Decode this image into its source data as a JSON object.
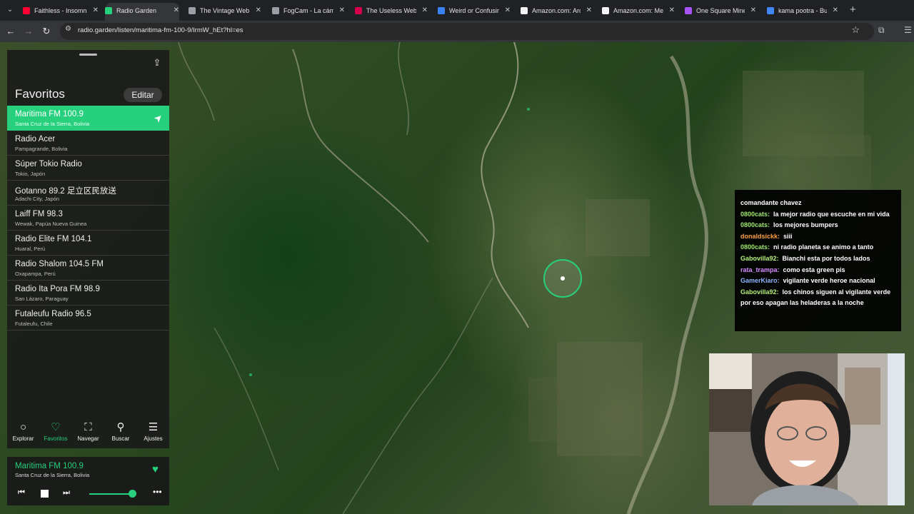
{
  "browser": {
    "tabs": [
      {
        "title": "Faithless - Insomnia",
        "favicon_color": "#ff0033",
        "active": false
      },
      {
        "title": "Radio Garden",
        "favicon_color": "#26d07c",
        "active": true
      },
      {
        "title": "The Vintage Web",
        "favicon_color": "#9aa0a6",
        "active": false
      },
      {
        "title": "FogCam - La cámara",
        "favicon_color": "#9aa0a6",
        "active": false
      },
      {
        "title": "The Useless Web",
        "favicon_color": "#d6004b",
        "active": false
      },
      {
        "title": "Weird or Confusing",
        "favicon_color": "#3b82f6",
        "active": false
      },
      {
        "title": "Amazon.com: Arcade",
        "favicon_color": "#f3f3f3",
        "active": false
      },
      {
        "title": "Amazon.com: Men",
        "favicon_color": "#f3f3f3",
        "active": false
      },
      {
        "title": "One Square Minesweeper",
        "favicon_color": "#a855f7",
        "active": false
      },
      {
        "title": "kama pootra - Buscar",
        "favicon_color": "#4285f4",
        "active": false
      }
    ],
    "url": "radio.garden/listen/maritima-fm-100-9/IrmW_hEt?hl=es"
  },
  "panel": {
    "title": "Favoritos",
    "edit_label": "Editar",
    "stations": [
      {
        "name": "Maritima FM 100.9",
        "place": "Santa Cruz de la Sierra, Bolivia",
        "active": true
      },
      {
        "name": "Radio Acer",
        "place": "Pampagrande, Bolivia",
        "active": false
      },
      {
        "name": "Súper Tokio Radio",
        "place": "Tokio, Japón",
        "active": false
      },
      {
        "name": "Gotanno 89.2 足立区民放送",
        "place": "Adachi City, Japón",
        "active": false
      },
      {
        "name": "Laiff FM 98.3",
        "place": "Wewak, Papúa Nueva Guinea",
        "active": false
      },
      {
        "name": "Radio Elite FM 104.1",
        "place": "Huaral, Perú",
        "active": false
      },
      {
        "name": "Radio Shalom 104.5 FM",
        "place": "Oxapampa, Perú",
        "active": false
      },
      {
        "name": "Radio Ita Pora FM 98.9",
        "place": "San Lázaro, Paraguay",
        "active": false
      },
      {
        "name": "Futaleufu Radio 96.5",
        "place": "Futaleufu, Chile",
        "active": false
      }
    ],
    "nav": [
      {
        "label": "Explorar",
        "icon": "circle-icon",
        "selected": false
      },
      {
        "label": "Favoritos",
        "icon": "heart-icon",
        "selected": true
      },
      {
        "label": "Navegar",
        "icon": "map-icon",
        "selected": false
      },
      {
        "label": "Buscar",
        "icon": "search-icon",
        "selected": false
      },
      {
        "label": "Ajustes",
        "icon": "menu-icon",
        "selected": false
      }
    ]
  },
  "player": {
    "station": "Maritima FM 100.9",
    "place": "Santa Cruz de la Sierra, Bolivia",
    "volume": 0.9
  },
  "chat": [
    {
      "user": "",
      "color": "#ffffff",
      "text": "comandante chavez"
    },
    {
      "user": "0800cats:",
      "color": "#9ee86b",
      "text": "la mejor radio que escuche en mi vida"
    },
    {
      "user": "0800cats:",
      "color": "#9ee86b",
      "text": "los mejores bumpers"
    },
    {
      "user": "donaldsickk:",
      "color": "#ff9f40",
      "text": "siii"
    },
    {
      "user": "0800cats:",
      "color": "#9ee86b",
      "text": "ni radio planeta se animo a tanto"
    },
    {
      "user": "Gabovilla92:",
      "color": "#b6f07a",
      "text": "Bianchi esta por todos lados"
    },
    {
      "user": "rata_trampa:",
      "color": "#d58cff",
      "text": "como esta green pis"
    },
    {
      "user": "GamerKiaro:",
      "color": "#8fb4ff",
      "text": "vigilante verde heroe nacional"
    },
    {
      "user": "Gabovilla92:",
      "color": "#b6f07a",
      "text": "los chinos siguen al vigilante verde por eso apagan las heladeras a la noche"
    }
  ],
  "colors": {
    "accent": "#26d07c"
  }
}
